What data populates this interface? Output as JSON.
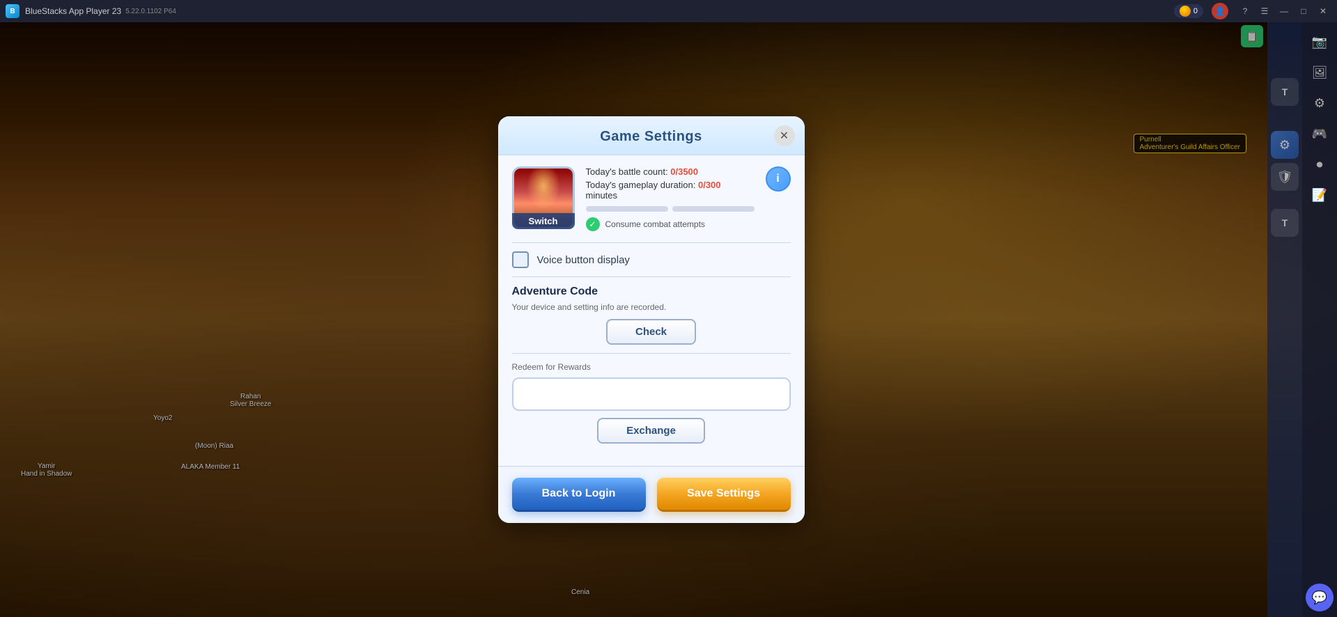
{
  "app": {
    "title": "BlueStacks App Player 23",
    "subtitle": "5.22.0.1102 P64",
    "coin_count": "0"
  },
  "titlebar": {
    "back_label": "←",
    "home_label": "⌂",
    "copy_label": "⧉",
    "minimize_label": "—",
    "restore_label": "□",
    "close_label": "✕"
  },
  "modal": {
    "title": "Game Settings",
    "close_label": "✕",
    "account": {
      "switch_label": "Switch",
      "battle_count_label": "Today's battle count:",
      "battle_count_value": "0/3500",
      "duration_label": "Today's gameplay duration:",
      "duration_value": "0/300",
      "duration_unit": "minutes",
      "consume_label": "Consume combat attempts"
    },
    "voice": {
      "label": "Voice button display"
    },
    "adventure": {
      "title": "Adventure Code",
      "desc": "Your device and setting info are recorded.",
      "check_label": "Check"
    },
    "redeem": {
      "label": "Redeem for Rewards",
      "placeholder": "",
      "exchange_label": "Exchange"
    },
    "footer": {
      "back_login_label": "Back to Login",
      "save_settings_label": "Save Settings"
    }
  },
  "game": {
    "npc_name": "Purnell",
    "npc_title": "Adventurer's Guild Affairs Officer",
    "player1": "Yamir\nHand in Shadow",
    "player2": "Yoyo2",
    "player3": "(Moon) Riaa",
    "player4": "Rahan\nSilver Breeze",
    "player5": "ALAKA Member 11",
    "cenia_label": "Cenia"
  },
  "sidebar": {
    "icons": [
      "📷",
      "⚙",
      "🛡",
      "💬",
      "⚙",
      "🛡",
      "💬"
    ]
  }
}
